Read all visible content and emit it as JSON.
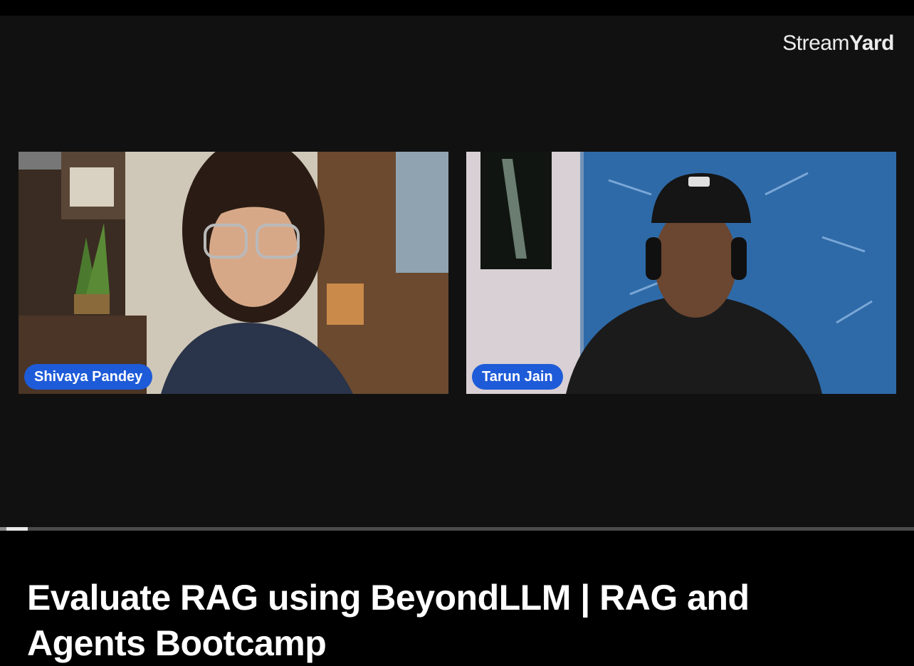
{
  "brand": {
    "name_part1": "Stream",
    "name_part2": "Yard"
  },
  "participants": [
    {
      "name": "Shivaya Pandey"
    },
    {
      "name": "Tarun Jain"
    }
  ],
  "player": {
    "progress_fraction": 0.03
  },
  "video": {
    "title": "Evaluate RAG using BeyondLLM | RAG and Agents Bootcamp"
  },
  "colors": {
    "name_pill": "#1e5bd8",
    "background": "#111111",
    "title_text": "#ffffff"
  }
}
